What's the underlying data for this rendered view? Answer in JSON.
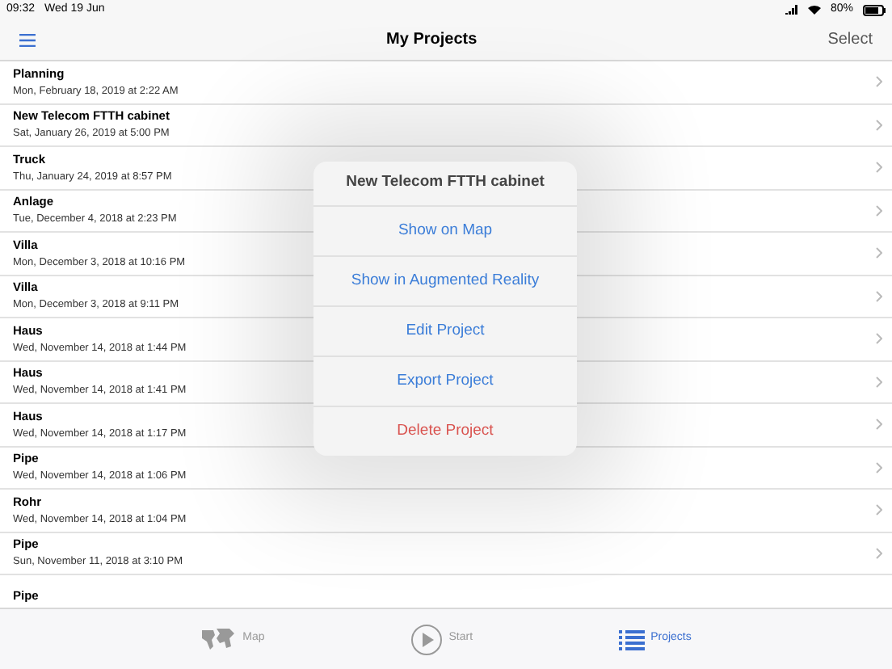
{
  "status_bar": {
    "time": "09:32",
    "date": "Wed 19 Jun",
    "battery": "80%"
  },
  "nav_bar": {
    "title": "My Projects",
    "action": "Select"
  },
  "projects": [
    {
      "name": "Planning",
      "date": "Mon, February 18, 2019 at 2:22 AM"
    },
    {
      "name": "New Telecom FTTH cabinet",
      "date": "Sat, January 26, 2019 at 5:00 PM"
    },
    {
      "name": "Truck",
      "date": "Thu, January 24, 2019 at 8:57 PM"
    },
    {
      "name": "Anlage",
      "date": "Tue, December 4, 2018 at 2:23 PM"
    },
    {
      "name": "Villa",
      "date": "Mon, December 3, 2018 at 10:16 PM"
    },
    {
      "name": "Villa",
      "date": "Mon, December 3, 2018 at 9:11 PM"
    },
    {
      "name": "Haus",
      "date": "Wed, November 14, 2018 at 1:44 PM"
    },
    {
      "name": "Haus",
      "date": "Wed, November 14, 2018 at 1:41 PM"
    },
    {
      "name": "Haus",
      "date": "Wed, November 14, 2018 at 1:17 PM"
    },
    {
      "name": "Pipe",
      "date": "Wed, November 14, 2018 at 1:06 PM"
    },
    {
      "name": "Rohr",
      "date": "Wed, November 14, 2018 at 1:04 PM"
    },
    {
      "name": "Pipe",
      "date": "Sun, November 11, 2018 at 3:10 PM"
    },
    {
      "name": "Pipe"
    }
  ],
  "popover": {
    "title": "New Telecom FTTH cabinet",
    "actions": [
      {
        "label": "Show on Map",
        "kind": "normal"
      },
      {
        "label": "Show in Augmented Reality",
        "kind": "normal"
      },
      {
        "label": "Edit Project",
        "kind": "normal"
      },
      {
        "label": "Export Project",
        "kind": "normal"
      },
      {
        "label": "Delete Project",
        "kind": "destructive"
      }
    ]
  },
  "tab_bar": [
    {
      "label": "Map",
      "kind": "map",
      "selected": false
    },
    {
      "label": "Start",
      "kind": "play",
      "selected": false
    },
    {
      "label": "Projects",
      "kind": "list",
      "selected": true
    }
  ]
}
